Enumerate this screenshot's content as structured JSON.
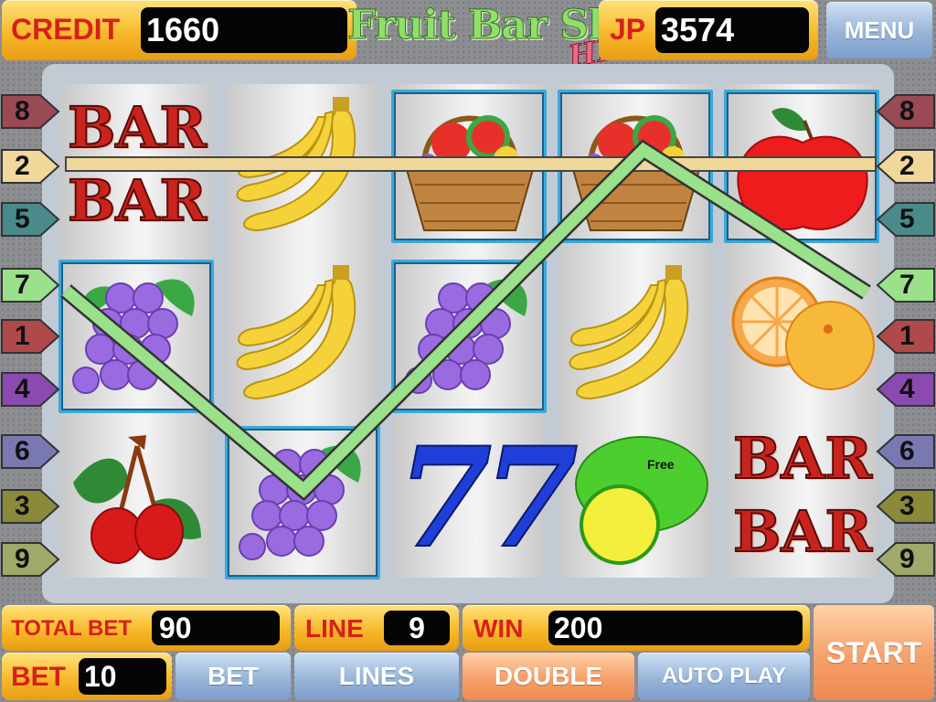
{
  "header": {
    "credit_label": "CREDIT",
    "credit_value": "1660",
    "title": "Fruit Bar Slot",
    "title_badge": "HD",
    "jp_label": "JP",
    "jp_value": "3574",
    "menu_label": "MENU"
  },
  "paylines_left": [
    "8",
    "2",
    "5",
    "7",
    "1",
    "4",
    "6",
    "3",
    "9"
  ],
  "paylines_right": [
    "8",
    "2",
    "5",
    "7",
    "1",
    "4",
    "6",
    "3",
    "9"
  ],
  "reels": [
    [
      "bar-bar",
      "grapes",
      "cherries"
    ],
    [
      "banana",
      "banana",
      "grapes"
    ],
    [
      "fruit-basket",
      "grapes",
      "seven-seven"
    ],
    [
      "fruit-basket",
      "banana",
      "lemon-free"
    ],
    [
      "apple",
      "orange",
      "bar-bar"
    ]
  ],
  "symbols": {
    "bar_text": "BAR",
    "seven_text": "77",
    "free_text": "Free"
  },
  "footer": {
    "total_bet_label": "TOTAL BET",
    "total_bet_value": "90",
    "line_label": "LINE",
    "line_value": "9",
    "win_label": "WIN",
    "win_value": "200",
    "bet_label": "BET",
    "bet_value": "10",
    "bet_button": "BET",
    "lines_button": "LINES",
    "double_button": "DOUBLE",
    "auto_play_button": "AUTO PLAY",
    "start_button": "START"
  },
  "colors": {
    "accent_gold": "#f7b92a",
    "label_red": "#d8201a",
    "winline_green": "#9be08a",
    "payline_tan": "#f0d89a",
    "highlight": "#3aa9dc"
  }
}
